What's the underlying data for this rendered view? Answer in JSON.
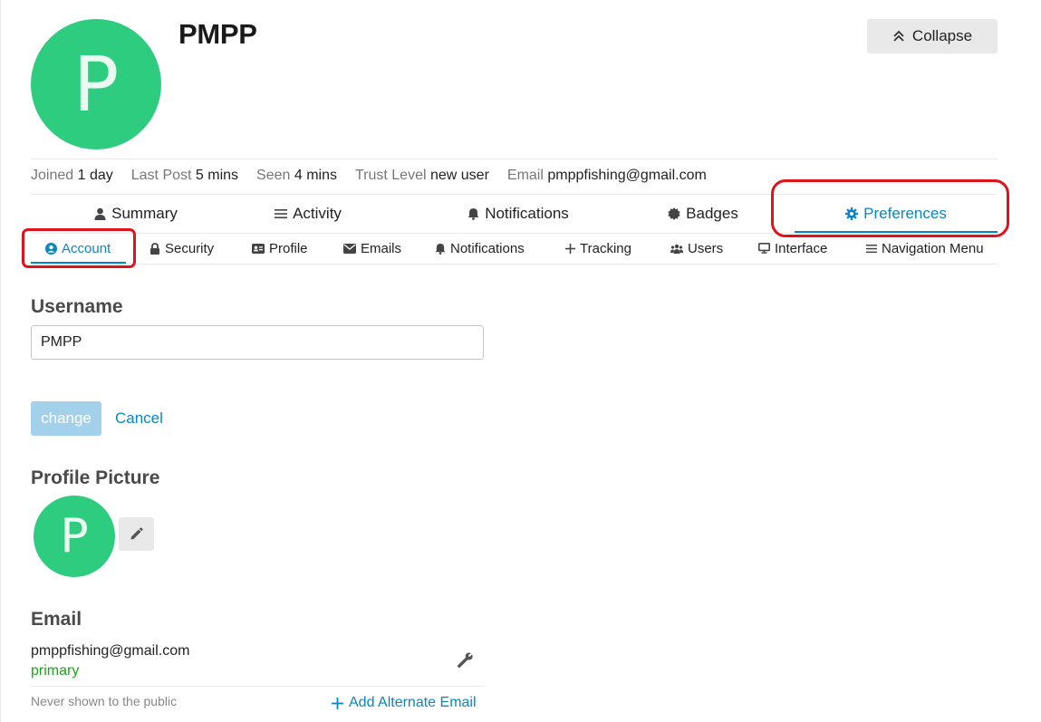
{
  "header": {
    "avatar_letter": "P",
    "username": "PMPP",
    "collapse_label": "Collapse"
  },
  "meta": {
    "joined_label": "Joined",
    "joined_value": "1 day",
    "last_post_label": "Last Post",
    "last_post_value": "5 mins",
    "seen_label": "Seen",
    "seen_value": "4 mins",
    "trust_label": "Trust Level",
    "trust_value": "new user",
    "email_label": "Email",
    "email_value": "pmppfishing@gmail.com"
  },
  "primary_nav": {
    "items": [
      {
        "label": "Summary",
        "icon": "user-icon"
      },
      {
        "label": "Activity",
        "icon": "list-icon"
      },
      {
        "label": "Notifications",
        "icon": "bell-icon"
      },
      {
        "label": "Badges",
        "icon": "certificate-icon"
      },
      {
        "label": "Preferences",
        "icon": "gear-icon",
        "active": true
      }
    ]
  },
  "secondary_nav": {
    "items": [
      {
        "label": "Account",
        "icon": "user-circle-icon",
        "active": true
      },
      {
        "label": "Security",
        "icon": "lock-icon"
      },
      {
        "label": "Profile",
        "icon": "id-card-icon"
      },
      {
        "label": "Emails",
        "icon": "envelope-icon"
      },
      {
        "label": "Notifications",
        "icon": "bell-icon"
      },
      {
        "label": "Tracking",
        "icon": "plus-icon"
      },
      {
        "label": "Users",
        "icon": "users-icon"
      },
      {
        "label": "Interface",
        "icon": "desktop-icon"
      },
      {
        "label": "Navigation Menu",
        "icon": "bars-icon"
      }
    ]
  },
  "username_section": {
    "heading": "Username",
    "value": "PMPP",
    "change_label": "change",
    "cancel_label": "Cancel"
  },
  "picture_section": {
    "heading": "Profile Picture",
    "avatar_letter": "P"
  },
  "email_section": {
    "heading": "Email",
    "address": "pmppfishing@gmail.com",
    "status": "primary",
    "note": "Never shown to the public",
    "add_label": "Add Alternate Email"
  },
  "colors": {
    "accent": "#0a86c2",
    "avatar": "#2ecc7f",
    "annotation": "#e0131b",
    "primary_status": "#1ca51c"
  }
}
